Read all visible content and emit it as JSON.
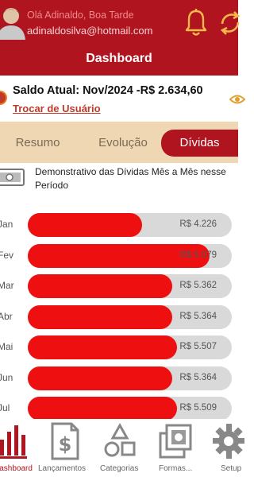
{
  "header": {
    "greeting": "Olá Adinaldo, Boa Tarde",
    "email": "adinaldosilva@hotmail.com",
    "title": "Dashboard"
  },
  "balance": {
    "text": "Saldo Atual: Nov/2024 -R$ 2.634,60",
    "switch_user_label": "Trocar de Usuário"
  },
  "tabs": [
    {
      "label": "Resumo",
      "active": false
    },
    {
      "label": "Evolução",
      "active": false
    },
    {
      "label": "Dívidas",
      "active": true
    }
  ],
  "section": {
    "title": "Demonstrativo das Dívidas Mês a Mês nesse Período",
    "icon": "money-bill-icon"
  },
  "months": [
    {
      "label": "Jan",
      "value_text": "R$ 4.226",
      "fraction": 0.56
    },
    {
      "label": "Fev",
      "value_text": "R$ 5.079",
      "fraction": 0.89
    },
    {
      "label": "Mar",
      "value_text": "R$ 5.362",
      "fraction": 0.71
    },
    {
      "label": "Abr",
      "value_text": "R$ 5.364",
      "fraction": 0.71
    },
    {
      "label": "Mai",
      "value_text": "R$ 5.507",
      "fraction": 0.73
    },
    {
      "label": "Jun",
      "value_text": "R$ 5.364",
      "fraction": 0.71
    },
    {
      "label": "Jul",
      "value_text": "R$ 5.509",
      "fraction": 0.73
    }
  ],
  "nav": [
    {
      "label": "Dashboard",
      "icon": "bar-chart-icon",
      "active": true
    },
    {
      "label": "Lançamentos",
      "icon": "dollar-document-icon",
      "active": false
    },
    {
      "label": "Categorias",
      "icon": "shapes-icon",
      "active": false
    },
    {
      "label": "Formas...",
      "icon": "money-stack-icon",
      "active": false
    },
    {
      "label": "Setup",
      "icon": "gear-icon",
      "active": false
    }
  ],
  "colors": {
    "brand": "#b0141f",
    "bar_fill": "#ee1010",
    "bar_track": "#d9d9d9",
    "tab_bg": "#f0d7b4",
    "link": "#c0392b"
  }
}
